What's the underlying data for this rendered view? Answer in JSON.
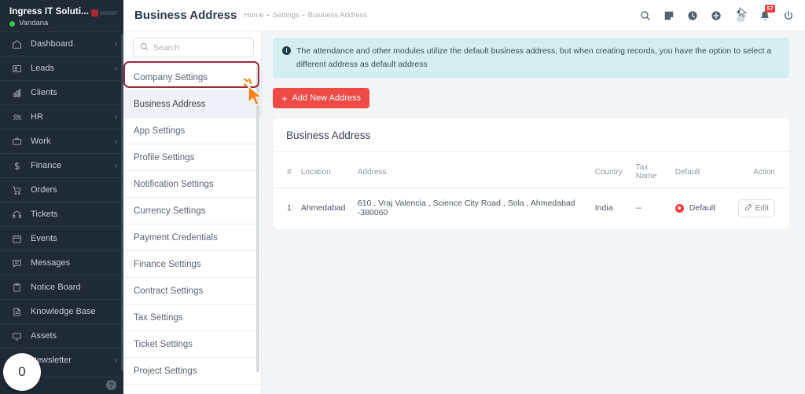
{
  "sidebar": {
    "company": "Ingress IT Soluti...",
    "user": "Vandana",
    "status_color": "#2ecc40",
    "badge_count": "0",
    "help_label": "?",
    "items": [
      {
        "label": "Dashboard",
        "icon": "home-icon",
        "chevron": "›"
      },
      {
        "label": "Leads",
        "icon": "leads-icon",
        "chevron": "›"
      },
      {
        "label": "Clients",
        "icon": "clients-icon",
        "chevron": ""
      },
      {
        "label": "HR",
        "icon": "hr-icon",
        "chevron": "›"
      },
      {
        "label": "Work",
        "icon": "work-icon",
        "chevron": "›"
      },
      {
        "label": "Finance",
        "icon": "finance-icon",
        "chevron": "›"
      },
      {
        "label": "Orders",
        "icon": "orders-icon",
        "chevron": ""
      },
      {
        "label": "Tickets",
        "icon": "tickets-icon",
        "chevron": ""
      },
      {
        "label": "Events",
        "icon": "events-icon",
        "chevron": ""
      },
      {
        "label": "Messages",
        "icon": "messages-icon",
        "chevron": ""
      },
      {
        "label": "Notice Board",
        "icon": "notice-board-icon",
        "chevron": ""
      },
      {
        "label": "Knowledge Base",
        "icon": "knowledge-base-icon",
        "chevron": ""
      },
      {
        "label": "Assets",
        "icon": "assets-icon",
        "chevron": ""
      },
      {
        "label": "Newsletter",
        "icon": "newsletter-icon",
        "chevron": "›"
      }
    ]
  },
  "topbar": {
    "title": "Business Address",
    "breadcrumb": [
      "Home",
      "Settings",
      "Business Address"
    ],
    "separator": "•",
    "notification_count": "57",
    "icons": [
      "search-icon",
      "note-icon",
      "clock-icon",
      "plus-icon",
      "avatar-icon",
      "bell-icon",
      "power-icon"
    ]
  },
  "settings": {
    "search_placeholder": "Search",
    "search_value": "",
    "active_item": "Business Address",
    "items": [
      "Company Settings",
      "Business Address",
      "App Settings",
      "Profile Settings",
      "Notification Settings",
      "Currency Settings",
      "Payment Credentials",
      "Finance Settings",
      "Contract Settings",
      "Tax Settings",
      "Ticket Settings",
      "Project Settings"
    ]
  },
  "notice": {
    "text": "The attendance and other modules utilize the default business address, but when creating records, you have the option to select a different address as default address",
    "icon": "info-icon",
    "bg_color": "#d4eff0"
  },
  "actions": {
    "add_new_address": "Add New Address",
    "add_icon": "plus-icon",
    "accent_color": "#f04a46"
  },
  "card": {
    "title": "Business Address",
    "columns": [
      "#",
      "Location",
      "Address",
      "Country",
      "Tax Name",
      "Default",
      "Action"
    ],
    "rows": [
      {
        "index": "1",
        "location": "Ahmedabad",
        "address": "610 , Vraj Valencia , Science City Road , Sola , Ahmedabad -380060",
        "country": "India",
        "tax_name": "--",
        "default_label": "Default",
        "default_selected": true,
        "action_label": "Edit",
        "action_icon": "edit-icon"
      }
    ]
  }
}
